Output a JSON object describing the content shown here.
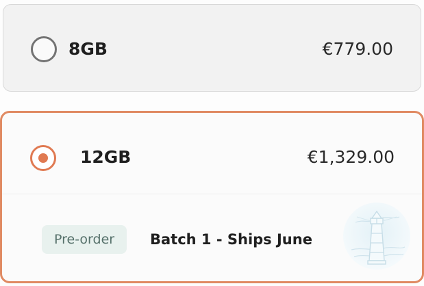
{
  "options": [
    {
      "label": "8GB",
      "price": "€779.00",
      "selected": false
    },
    {
      "label": "12GB",
      "price": "€1,329.00",
      "selected": true,
      "badge": "Pre-order",
      "shipping_text": "Batch 1 - Ships June",
      "illustration_icon": "lighthouse-icon"
    }
  ],
  "colors": {
    "accent": "#e07a52",
    "selected_border": "#e08a62",
    "unselected_radio": "#737373",
    "badge_bg": "#e8f1ee",
    "badge_text": "#55706a"
  }
}
